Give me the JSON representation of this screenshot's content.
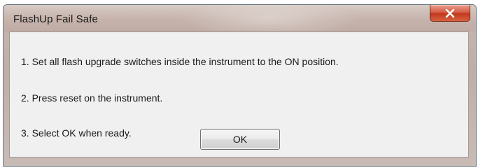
{
  "window": {
    "title": "FlashUp Fail Safe"
  },
  "titlebar": {
    "close_icon": "close-x-icon"
  },
  "message": {
    "line1": "1. Set all flash upgrade switches inside the instrument to the ON position.",
    "line2": "2. Press reset on the instrument.",
    "line3": "3. Select OK when ready."
  },
  "buttons": {
    "ok_label": "OK"
  },
  "colors": {
    "close_button": "#c2391f",
    "client_background": "#f0f0f0",
    "titlebar": "#c6b3ac"
  }
}
